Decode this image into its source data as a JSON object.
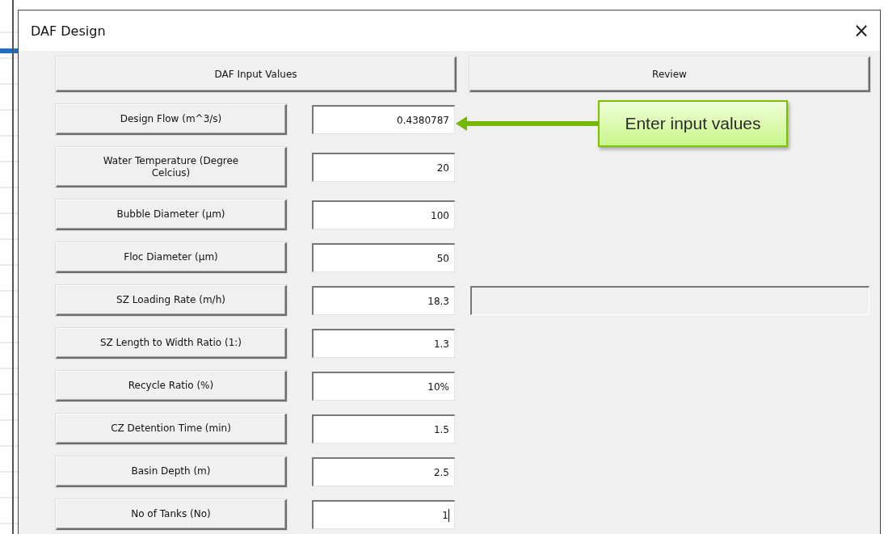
{
  "window": {
    "title": "DAF Design",
    "close": "×"
  },
  "tabs": [
    {
      "label": "DAF Input Values"
    },
    {
      "label": "Review"
    }
  ],
  "rows": [
    {
      "label": "Design Flow (m^3/s)",
      "value": "0.4380787",
      "focused": false,
      "result_field": false
    },
    {
      "label": "Water Temperature (Degree Celcius)",
      "value": "20",
      "focused": false,
      "result_field": false
    },
    {
      "label": "Bubble Diameter (µm)",
      "value": "100",
      "focused": false,
      "result_field": false
    },
    {
      "label": "Floc Diameter (µm)",
      "value": "50",
      "focused": false,
      "result_field": false
    },
    {
      "label": "SZ Loading Rate (m/h)",
      "value": "18.3",
      "focused": false,
      "result_field": true
    },
    {
      "label": "SZ Length to Width Ratio (1:)",
      "value": "1.3",
      "focused": false,
      "result_field": false
    },
    {
      "label": "Recycle Ratio (%)",
      "value": "10%",
      "focused": false,
      "result_field": false
    },
    {
      "label": "CZ Detention Time (min)",
      "value": "1.5",
      "focused": false,
      "result_field": false
    },
    {
      "label": "Basin Depth (m)",
      "value": "2.5",
      "focused": false,
      "result_field": false
    },
    {
      "label": "No of Tanks (No)",
      "value": "1",
      "focused": true,
      "result_field": false
    }
  ],
  "callout": {
    "text": "Enter input values"
  }
}
